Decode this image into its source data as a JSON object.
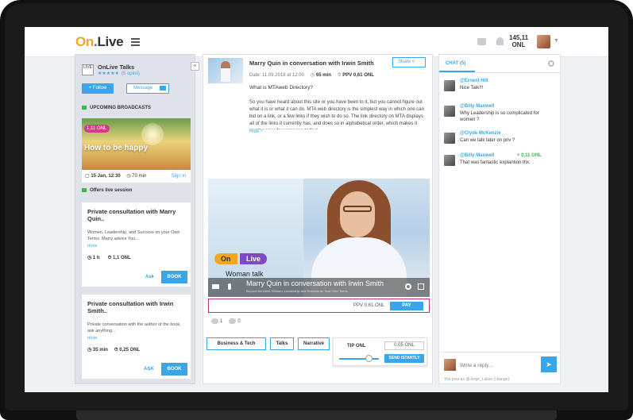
{
  "header": {
    "logo_on": "On",
    "logo_dot": ".",
    "logo_live": "Live",
    "balance_amount": "145,11",
    "balance_unit": "ONL"
  },
  "sidebar": {
    "channel_logo_text": "LIVE",
    "channel_name": "OnLive Talks",
    "stars": "★★★★★",
    "opinions": "(5 opinii)",
    "follow_label": "+ Follow",
    "message_label": "Message",
    "upcoming_title": "UPCOMING BROADCASTS",
    "broadcast": {
      "price": "1,11 ONL",
      "title": "How to be happy",
      "date": "15 Jan, 12:30",
      "duration": "70 min",
      "signin": "Sign in"
    },
    "offers_title": "Offers live session",
    "cards": [
      {
        "title": "Private consultation with Marry Quin..",
        "desc": "Women, Leadership, and Success on your Own Terms. Marry advice You...",
        "more": "more",
        "duration": "1 h",
        "price": "1,1 ONL",
        "ask": "Ask",
        "book": "BOOK"
      },
      {
        "title": "Private consultation with Irwin Smith..",
        "desc": "Private conversation with the author of the book, ask anything...",
        "more": "more",
        "duration": "35 min",
        "price": "0,25 ONL",
        "ask": "ASK",
        "book": "BOOK"
      }
    ]
  },
  "post": {
    "title": "Marry Quin in conversation with Irwin Smith",
    "share_label": "Share",
    "date": "Date: 11.09.2018 at 12:00",
    "duration": "65 min",
    "ppv": "PPV 0,61 ONL",
    "question": "What is MTAweb Directory?",
    "body": "So you have heard about this site or you have been to it, but you cannot figure out what it is or what it can do. MTA web directory is the simplest way in which one can bid on a link, or a few links if they wish to do so. The link directory on MTA displays all of the links it currently has, and does so in alphabetical order, which makes it much easier for someone to find",
    "hide_label": "Hide"
  },
  "video": {
    "logo_on": "On",
    "logo_live": "Live",
    "subtitle": "Woman talk",
    "title": "Marry Quin in conversation with Irwin Smith",
    "small": "Beyond the label: Women, Leadership and Success on Your Own Terms"
  },
  "payment": {
    "ppv": "PPV 0,61 ONL",
    "pay_label": "PAY"
  },
  "stats": {
    "comments": "1",
    "likes": "0"
  },
  "tags": [
    "Business & Tech",
    "Talks",
    "Narrative"
  ],
  "tip": {
    "label": "TIP ONL",
    "value": "0,05 ONL",
    "send_label": "SEND ISTANTLY",
    "slider_fraction": 0.75
  },
  "chat": {
    "tab_label": "CHAT (5)",
    "messages": [
      {
        "name": "@Ernest Hill",
        "text": "Nice Talk!!!",
        "tip": ""
      },
      {
        "name": "@Billy Maxwell",
        "text": "Why Leadership is so complicated for women ?",
        "tip": ""
      },
      {
        "name": "@Clyde McKenzie",
        "text": "Can we talk later on priv ?",
        "tip": ""
      },
      {
        "name": "@Billy Maxwell",
        "text": "That was fantastic explantion thx.",
        "tip": "+ 0,11 ONL"
      }
    ],
    "reply_placeholder": "Write a reply...",
    "posting_as": "You post as @Jorge_Lukas (change)"
  }
}
